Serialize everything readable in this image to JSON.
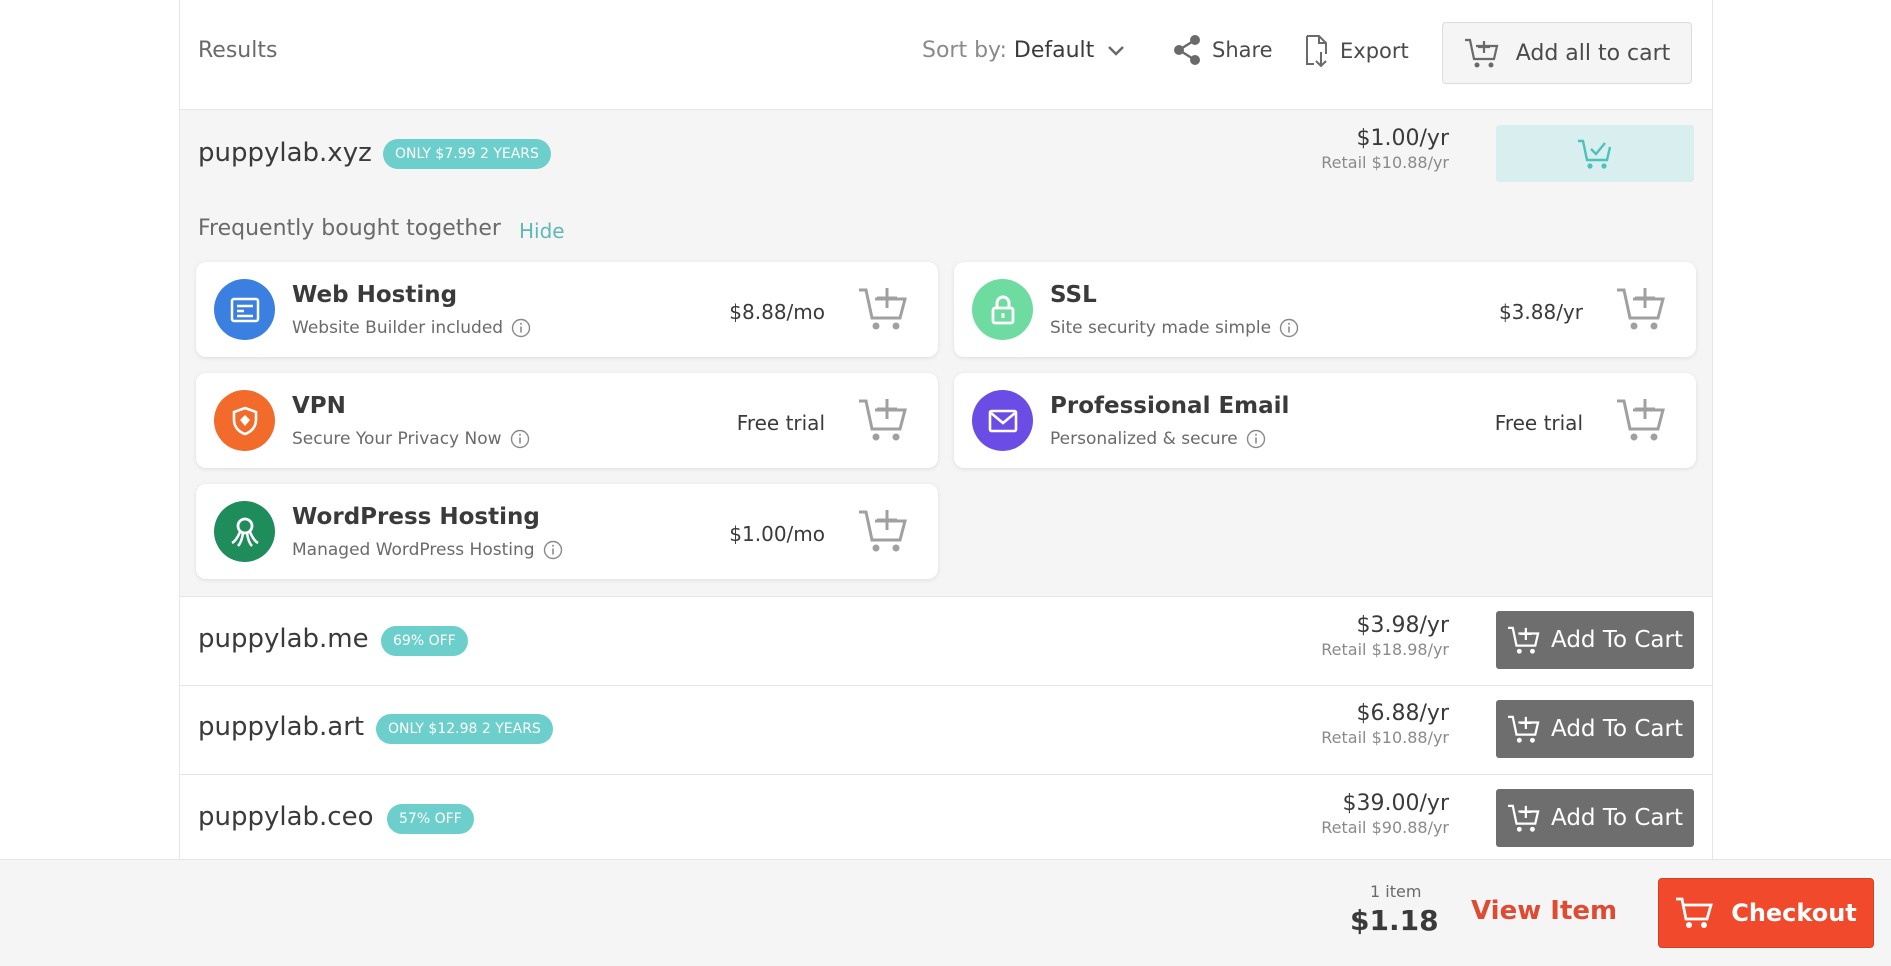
{
  "header": {
    "title": "Results",
    "sort_label": "Sort by:",
    "sort_value": "Default",
    "share_label": "Share",
    "export_label": "Export",
    "add_all_label": "Add all to cart"
  },
  "featured": {
    "domain": "puppylab.xyz",
    "badge": "ONLY $7.99 2 YEARS",
    "price": "$1.00/yr",
    "retail": "Retail $10.88/yr",
    "fbt_label": "Frequently bought together",
    "hide_label": "Hide",
    "addons": [
      {
        "title": "Web Hosting",
        "subtitle": "Website Builder included",
        "price": "$8.88/mo",
        "icon": "web-hosting-icon",
        "color": "#3b7fe0"
      },
      {
        "title": "SSL",
        "subtitle": "Site security made simple",
        "price": "$3.88/yr",
        "icon": "lock-icon",
        "color": "#6edba0"
      },
      {
        "title": "VPN",
        "subtitle": "Secure Your Privacy Now",
        "price": "Free trial",
        "icon": "vpn-icon",
        "color": "#f26b2a"
      },
      {
        "title": "Professional Email",
        "subtitle": "Personalized & secure",
        "price": "Free trial",
        "icon": "envelope-icon",
        "color": "#6b4de6"
      },
      {
        "title": "WordPress Hosting",
        "subtitle": "Managed WordPress Hosting",
        "price": "$1.00/mo",
        "icon": "wordpress-icon",
        "color": "#1f8c5c"
      }
    ]
  },
  "results": [
    {
      "domain": "puppylab.me",
      "badge": "69% OFF",
      "price": "$3.98/yr",
      "retail": "Retail $18.98/yr",
      "button": "Add To Cart"
    },
    {
      "domain": "puppylab.art",
      "badge": "ONLY $12.98 2 YEARS",
      "price": "$6.88/yr",
      "retail": "Retail $10.88/yr",
      "button": "Add To Cart"
    },
    {
      "domain": "puppylab.ceo",
      "badge": "57% OFF",
      "price": "$39.00/yr",
      "retail": "Retail $90.88/yr",
      "button": "Add To Cart"
    }
  ],
  "footer": {
    "item_count": "1 item",
    "total": "$1.18",
    "view_label": "View Item",
    "checkout_label": "Checkout"
  },
  "colors": {
    "accent_teal": "#6dcfcb",
    "checkout": "#f0492b",
    "view_item": "#dd4b32"
  }
}
